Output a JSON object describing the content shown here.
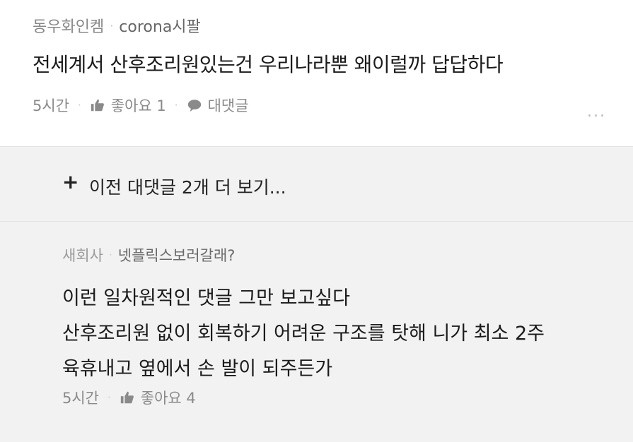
{
  "comment": {
    "nickname": "동우화인켐",
    "username": "corona시팔",
    "text": "전세계서 산후조리원있는건 우리나라뿐 왜이럴까  답답하다",
    "time": "5시간",
    "like_label": "좋아요 1",
    "reply_label": "대댓글",
    "more": "..."
  },
  "previous_replies": {
    "label": "이전 대댓글 2개 더 보기..."
  },
  "reply": {
    "nickname": "새회사",
    "username": "넷플릭스보러갈래?",
    "lines": [
      "이런 일차원적인 댓글 그만 보고싶다",
      "산후조리원 없이 회복하기 어려운 구조를 탓해 니가 최소 2주",
      "육휴내고 옆에서 손 발이 되주든가"
    ],
    "time": "5시간",
    "like_label": "좋아요 4"
  },
  "colors": {
    "thumb_icon": "#8a8a8a",
    "reply_bg": "#f2f2f2"
  }
}
